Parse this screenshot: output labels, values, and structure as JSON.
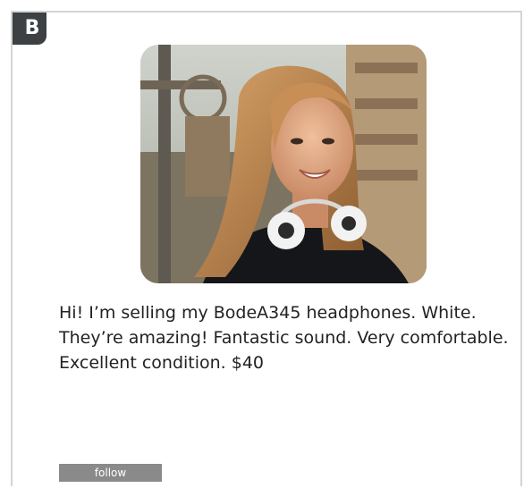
{
  "badge": {
    "label": "B"
  },
  "post": {
    "image": {
      "icon": "profile-photo"
    },
    "message": "Hi! I’m selling my BodeA345 headphones. White. They’re amazing! Fantastic sound. Very comfortable. Excellent condition. $40"
  },
  "actions": {
    "follow_label": "follow"
  },
  "colors": {
    "badge_bg": "#3d4143",
    "border": "#d4d4d4",
    "button_bg": "#8a8a8a",
    "text": "#222222"
  }
}
